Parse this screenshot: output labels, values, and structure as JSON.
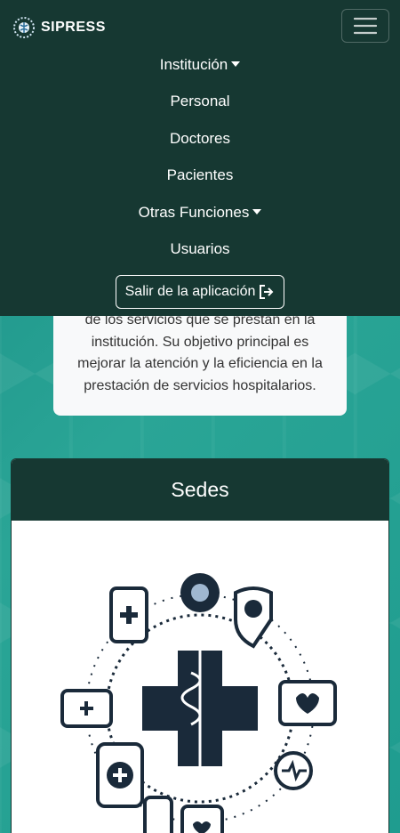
{
  "navbar": {
    "brand": "SIPRESS",
    "toggle_icon": "hamburger-menu-icon",
    "items": [
      {
        "label": "Institución",
        "dropdown": true
      },
      {
        "label": "Personal",
        "dropdown": false
      },
      {
        "label": "Doctores",
        "dropdown": false
      },
      {
        "label": "Pacientes",
        "dropdown": false
      },
      {
        "label": "Otras Funciones",
        "dropdown": true
      },
      {
        "label": "Usuarios",
        "dropdown": false
      }
    ],
    "logout_label": "Salir de la aplicación",
    "logout_icon": "sign-out-icon"
  },
  "intro": {
    "text": "de los servicios que se prestan en la institución. Su objetivo principal es mejorar la atención y la eficiencia en la prestación de servicios hospitalarios."
  },
  "sedes": {
    "title": "Sedes",
    "image_icon": "medical-icons-illustration"
  },
  "colors": {
    "navbar_bg": "#163832",
    "background": "#2aa596",
    "card_bg": "#f8f9fa"
  }
}
